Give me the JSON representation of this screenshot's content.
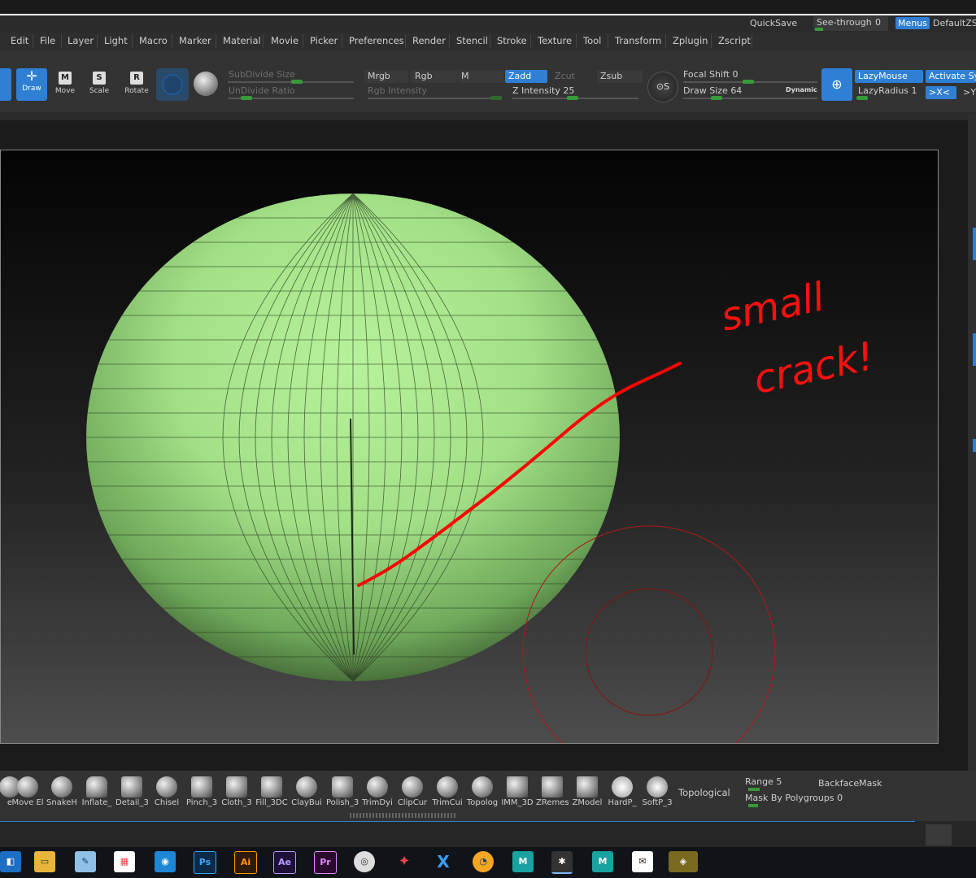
{
  "topbar": {
    "quicksave": "QuickSave",
    "see_through_label": "See-through",
    "see_through_value": "0",
    "menus": "Menus",
    "default_script": "DefaultZSc"
  },
  "menubar": [
    "Edit",
    "File",
    "Layer",
    "Light",
    "Macro",
    "Marker",
    "Material",
    "Movie",
    "Picker",
    "Preferences",
    "Render",
    "Stencil",
    "Stroke",
    "Texture",
    "Tool",
    "Transform",
    "Zplugin",
    "Zscript"
  ],
  "toolbar": {
    "modes": [
      "Draw",
      "Move",
      "Scale",
      "Rotate"
    ],
    "subdivide_size": "SubDivide Size",
    "undivide_ratio": "UnDivide Ratio",
    "mrgb": "Mrgb",
    "rgb": "Rgb",
    "m": "M",
    "rgb_intensity": "Rgb Intensity",
    "zadd": "Zadd",
    "zcut": "Zcut",
    "zsub": "Zsub",
    "z_intensity_label": "Z Intensity",
    "z_intensity_value": "25",
    "focal_shift_label": "Focal Shift",
    "focal_shift_value": "0",
    "draw_size_label": "Draw Size",
    "draw_size_value": "64",
    "dynamic": "Dynamic",
    "lazymouse": "LazyMouse",
    "lazyradius_label": "LazyRadius",
    "lazyradius_value": "1",
    "activate_sym": "Activate Sym",
    "sym_x": ">X<",
    "sym_y": ">Y<"
  },
  "annotation": {
    "line1": "small",
    "line2": "crack!"
  },
  "shelf": {
    "brushes": [
      "Move El",
      "SnakeH",
      "Inflate_",
      "Detail_3",
      "Chisel",
      "Pinch_3",
      "Cloth_3",
      "Fill_3DC",
      "ClayBui",
      "Polish_3",
      "TrimDyi",
      "ClipCur",
      "TrimCui",
      "Topolog",
      "IMM_3D",
      "ZRemes",
      "ZModel",
      "HardP_",
      "SoftP_3"
    ],
    "topological": "Topological",
    "range_label": "Range",
    "range_value": "5",
    "backface_mask": "BackfaceMask",
    "mask_polygroups_label": "Mask By Polygroups",
    "mask_polygroups_value": "0"
  },
  "taskbar": {
    "apps": [
      "Windows Explorer",
      "File Explorer",
      "Notes",
      "Store",
      "Device",
      "Ps",
      "Ai",
      "Ae",
      "Pr",
      "Chrome-like",
      "Tool",
      "X",
      "Blender",
      "Maya",
      "ZBrush",
      "Maya2",
      "Mail",
      "App"
    ]
  },
  "colors": {
    "accent_blue": "#2f7fd4",
    "sphere_green": "#a8ea8a",
    "annotation_red": "#ff0000"
  }
}
